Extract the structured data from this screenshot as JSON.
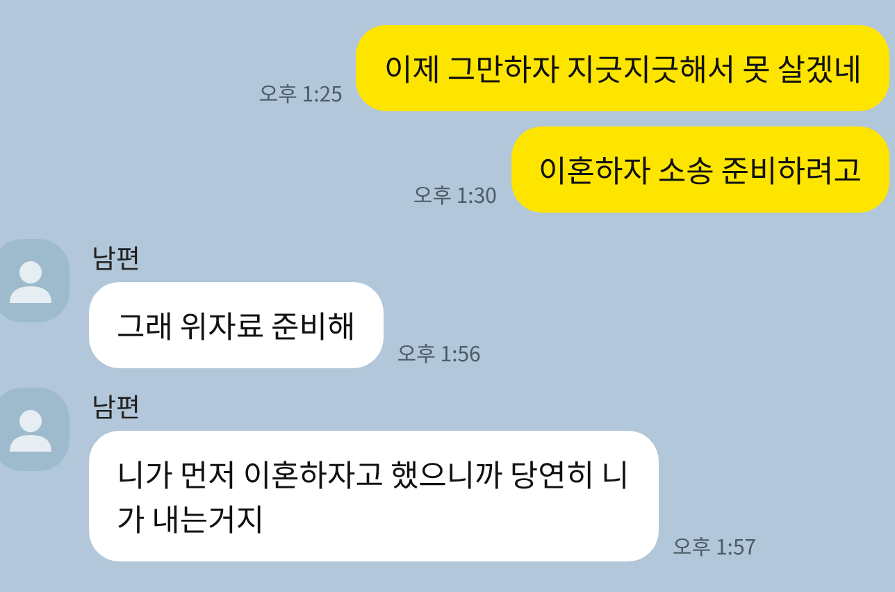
{
  "messages": [
    {
      "kind": "sent",
      "text": "이제 그만하자 지긋지긋해서 못 살겠네",
      "time": "오후 1:25"
    },
    {
      "kind": "sent",
      "text": "이혼하자 소송 준비하려고",
      "time": "오후 1:30"
    },
    {
      "kind": "received",
      "sender": "남편",
      "text": "그래 위자료 준비해",
      "time": "오후 1:56"
    },
    {
      "kind": "received",
      "sender": "남편",
      "text": "니가 먼저 이혼하자고 했으니까 당연히 니가 내는거지",
      "time": "오후 1:57"
    }
  ]
}
